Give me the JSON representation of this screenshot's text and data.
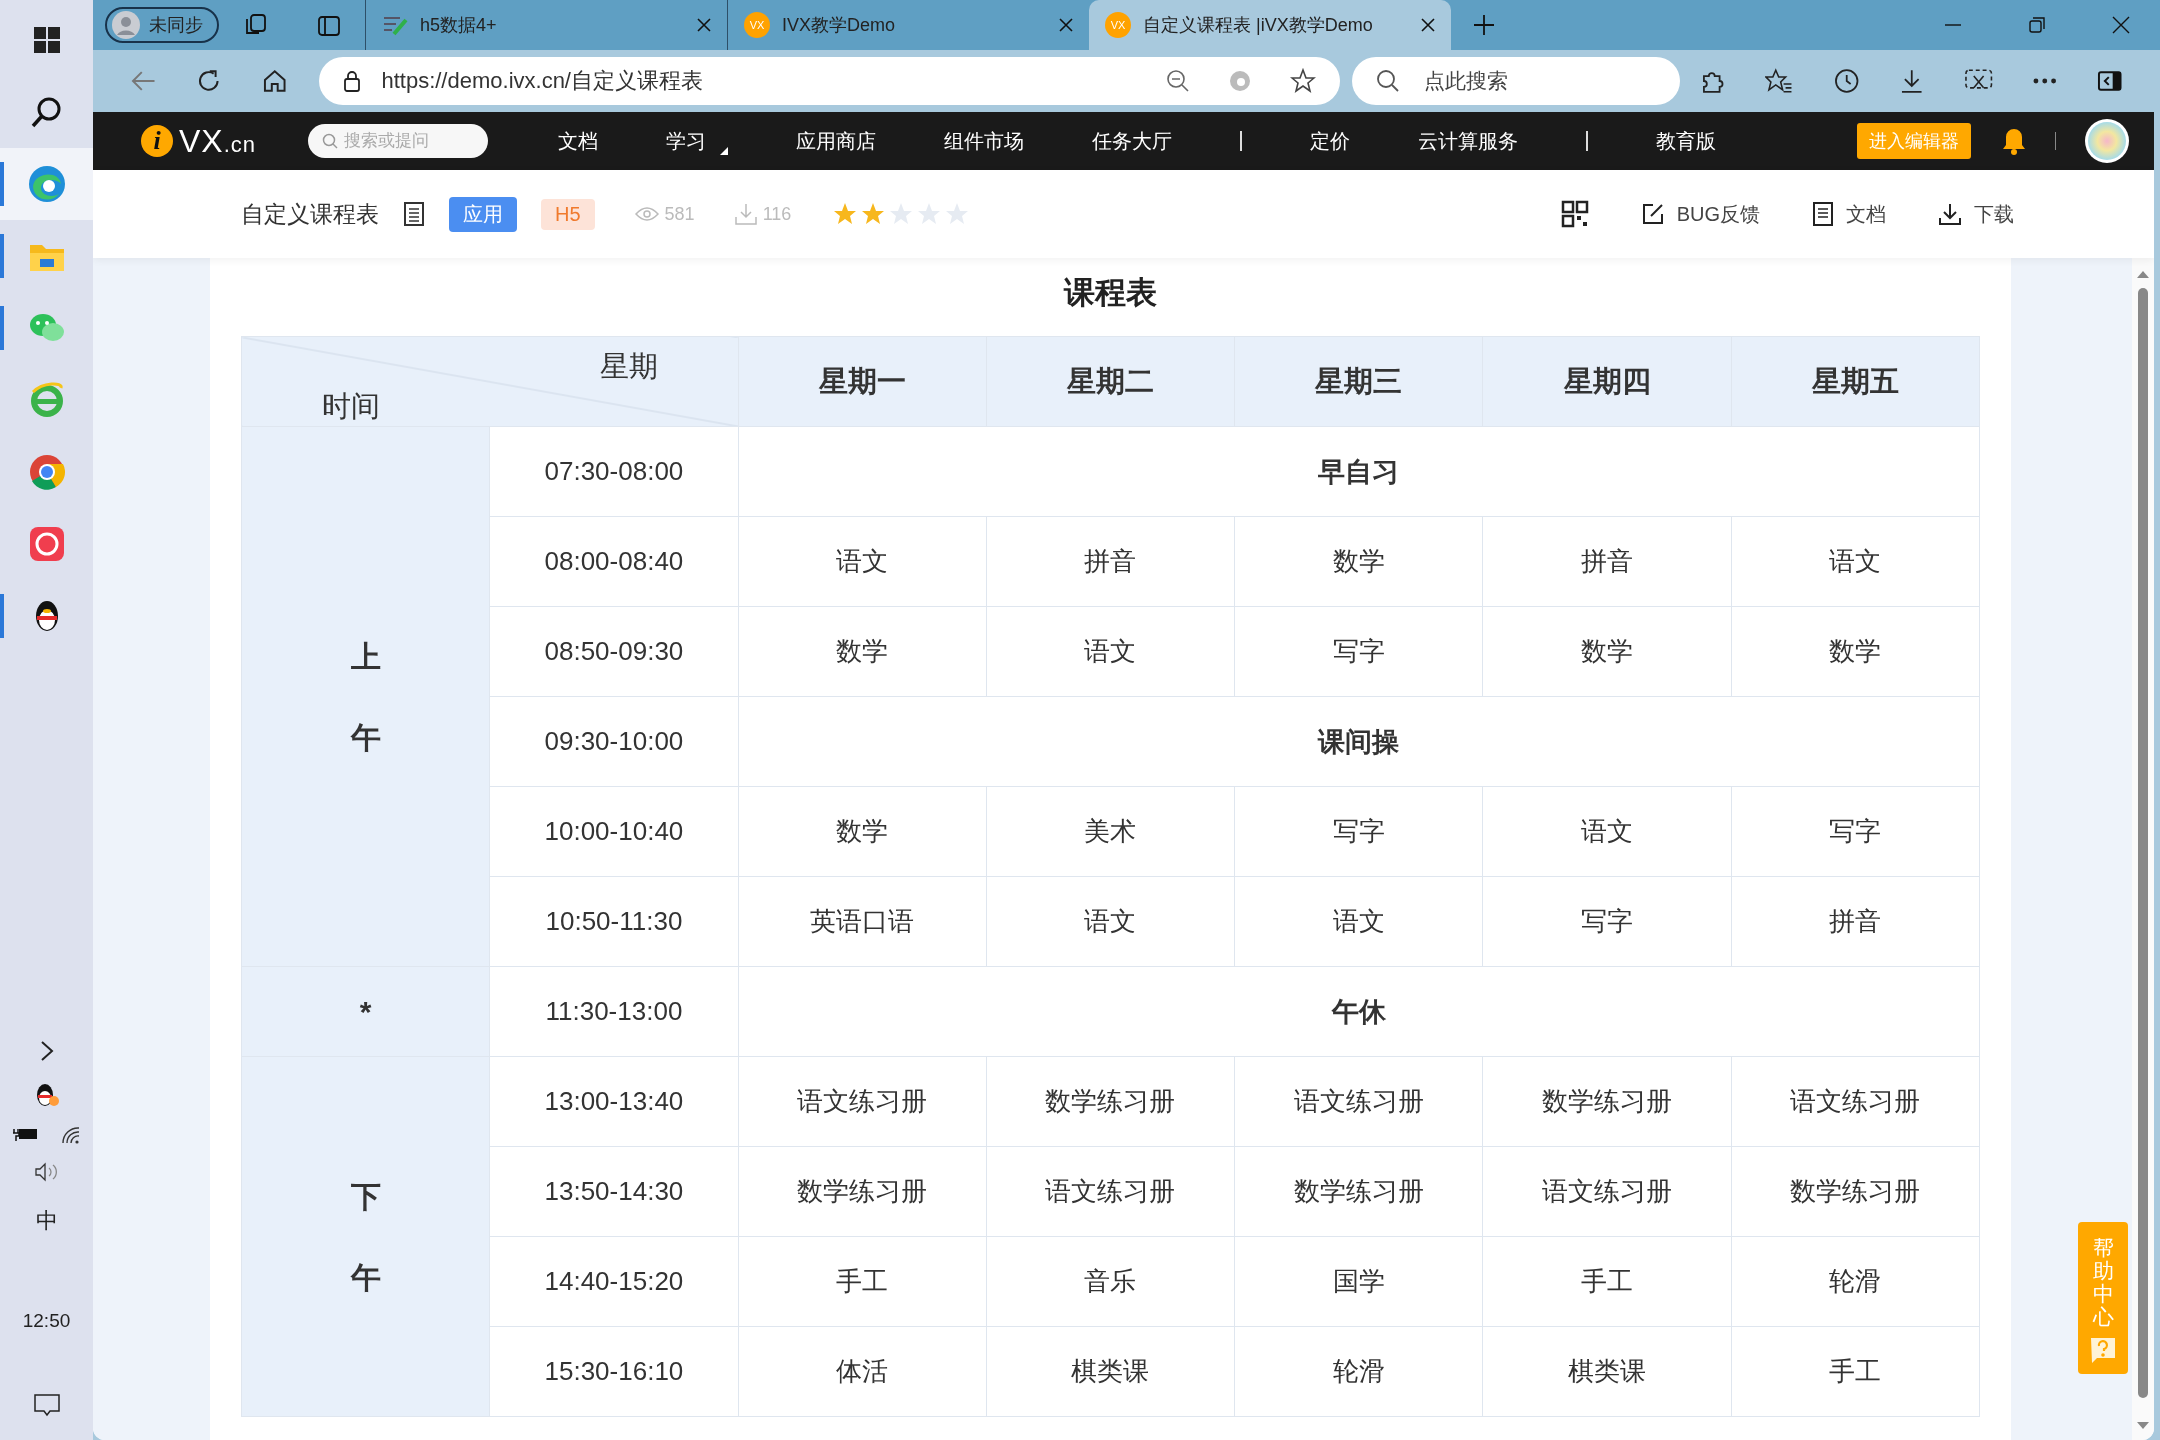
{
  "taskbar": {
    "apps": [
      {
        "kind": "windows",
        "selected": false,
        "running": false
      },
      {
        "kind": "search",
        "selected": false,
        "running": false
      },
      {
        "kind": "edge",
        "selected": true,
        "running": true
      },
      {
        "kind": "folder",
        "selected": false,
        "running": true
      },
      {
        "kind": "chat",
        "selected": false,
        "running": true
      },
      {
        "kind": "ie",
        "selected": false,
        "running": false
      },
      {
        "kind": "chrome",
        "selected": false,
        "running": false
      },
      {
        "kind": "redapp",
        "selected": false,
        "running": false
      },
      {
        "kind": "penguin",
        "selected": false,
        "running": true
      }
    ],
    "ime": "中",
    "clock": "12:50"
  },
  "browser": {
    "profile": "未同步",
    "tabs": [
      {
        "title": "h5数据4+",
        "kind": "doc",
        "selected": false
      },
      {
        "title": "IVX教学Demo",
        "kind": "ivx",
        "icon_text": "VX",
        "selected": false
      },
      {
        "title": "自定义课程表 |iVX教学Demo",
        "kind": "ivx",
        "icon_text": "VX",
        "selected": true
      }
    ],
    "url": "https://demo.ivx.cn/自定义课程表",
    "search": {
      "placeholder": "点此搜索"
    }
  },
  "site": {
    "logo": {
      "mark": "i",
      "name": "VX",
      "suffix": ".cn"
    },
    "search": {
      "placeholder": "搜索或提问"
    },
    "nav": [
      {
        "kind": "link",
        "label": "文档"
      },
      {
        "kind": "menu",
        "label": "学习"
      },
      {
        "kind": "link",
        "label": "应用商店"
      },
      {
        "kind": "link",
        "label": "组件市场"
      },
      {
        "kind": "link",
        "label": "任务大厅"
      },
      {
        "kind": "divider"
      },
      {
        "kind": "link",
        "label": "定价"
      },
      {
        "kind": "link",
        "label": "云计算服务"
      },
      {
        "kind": "divider"
      },
      {
        "kind": "link",
        "label": "教育版"
      }
    ],
    "editor_button": "进入编辑器"
  },
  "app": {
    "title": "自定义课程表",
    "badges": [
      {
        "label": "应用",
        "kind": "primary"
      },
      {
        "label": "H5",
        "kind": "tag"
      }
    ],
    "views": "581",
    "downloads": "116",
    "stars": 2,
    "actions": [
      {
        "label": "BUG反馈",
        "kind": "edit"
      },
      {
        "label": "文档",
        "kind": "doc"
      },
      {
        "label": "下载",
        "kind": "download"
      }
    ]
  },
  "timetable": {
    "title": "课程表",
    "corner": {
      "top": "星期",
      "bottom": "时间"
    },
    "days": [
      "星期一",
      "星期二",
      "星期三",
      "星期四",
      "星期五"
    ],
    "groups": [
      {
        "label": "上午",
        "rows": [
          {
            "time": "07:30-08:00",
            "kind": "break",
            "label": "早自习"
          },
          {
            "time": "08:00-08:40",
            "kind": "lessons",
            "cells": [
              "语文",
              "拼音",
              "数学",
              "拼音",
              "语文"
            ]
          },
          {
            "time": "08:50-09:30",
            "kind": "lessons",
            "cells": [
              "数学",
              "语文",
              "写字",
              "数学",
              "数学"
            ]
          },
          {
            "time": "09:30-10:00",
            "kind": "break",
            "label": "课间操"
          },
          {
            "time": "10:00-10:40",
            "kind": "lessons",
            "cells": [
              "数学",
              "美术",
              "写字",
              "语文",
              "写字"
            ]
          },
          {
            "time": "10:50-11:30",
            "kind": "lessons",
            "cells": [
              "英语口语",
              "语文",
              "语文",
              "写字",
              "拼音"
            ]
          }
        ]
      },
      {
        "label": "*",
        "rows": [
          {
            "time": "11:30-13:00",
            "kind": "break",
            "label": "午休"
          }
        ]
      },
      {
        "label": "下午",
        "rows": [
          {
            "time": "13:00-13:40",
            "kind": "lessons",
            "cells": [
              "语文练习册",
              "数学练习册",
              "语文练习册",
              "数学练习册",
              "语文练习册"
            ]
          },
          {
            "time": "13:50-14:30",
            "kind": "lessons",
            "cells": [
              "数学练习册",
              "语文练习册",
              "数学练习册",
              "语文练习册",
              "数学练习册"
            ]
          },
          {
            "time": "14:40-15:20",
            "kind": "lessons",
            "cells": [
              "手工",
              "音乐",
              "国学",
              "手工",
              "轮滑"
            ]
          },
          {
            "time": "15:30-16:10",
            "kind": "lessons",
            "cells": [
              "体活",
              "棋类课",
              "轮滑",
              "棋类课",
              "手工"
            ]
          }
        ]
      }
    ]
  },
  "help": "帮助中心"
}
